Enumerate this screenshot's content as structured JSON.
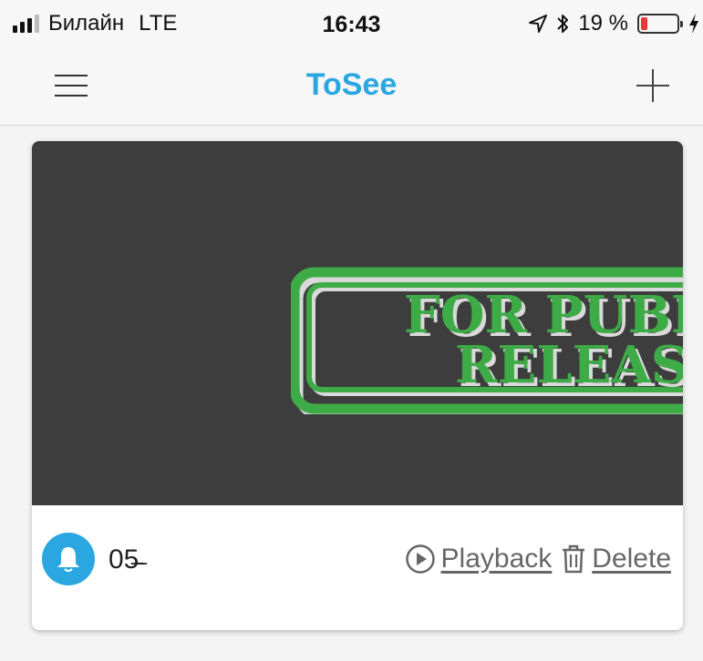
{
  "status_bar": {
    "carrier": "Билайн",
    "network": "LTE",
    "time": "16:43",
    "battery_percent": "19 %",
    "battery_level": 0.19
  },
  "nav": {
    "title": "ToSee",
    "icons": {
      "menu": "hamburger-icon",
      "add": "plus-icon"
    }
  },
  "camera": {
    "name": "05̵̶",
    "stamp_line1": "FOR PUBLIC",
    "stamp_line2": "RELEASE",
    "actions": {
      "playback": "Playback",
      "delete": "Delete"
    }
  },
  "colors": {
    "accent": "#2aa7e0",
    "thumb_bg": "#3d3d3d",
    "stamp_green": "#3eac46",
    "battery_low": "#e53935"
  }
}
